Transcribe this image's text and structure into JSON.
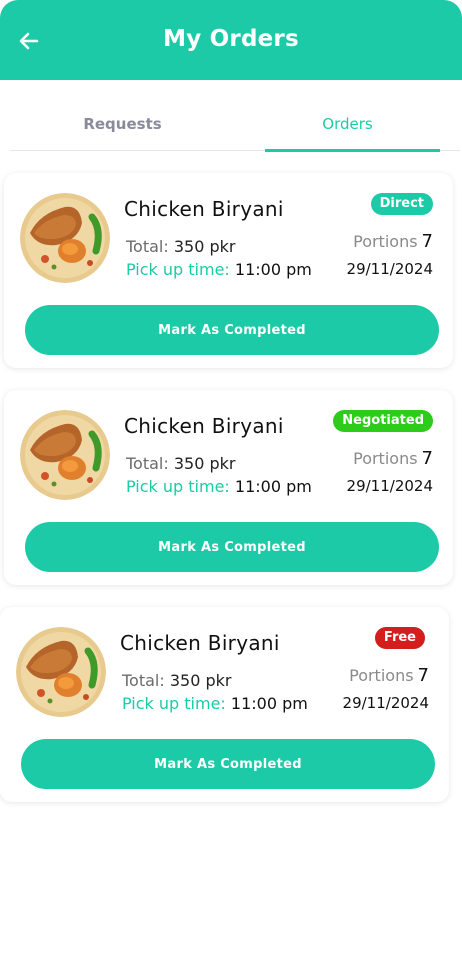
{
  "header": {
    "title": "My Orders",
    "back_icon": "arrow-left-icon",
    "color": "#1dcaa7"
  },
  "tabs": [
    {
      "label": "Requests",
      "active": false
    },
    {
      "label": "Orders",
      "active": true
    }
  ],
  "orders": [
    {
      "name": "Chicken Biryani",
      "badge": "Direct",
      "badge_color": "#1dcaa7",
      "total_label": "Total:",
      "total_value": "350 pkr",
      "pickup_label": "Pick up time:",
      "pickup_value": "11:00 pm",
      "portions_label": "Portions",
      "portions_value": "7",
      "date": "29/11/2024",
      "button_label": "Mark As Completed"
    },
    {
      "name": "Chicken Biryani",
      "badge": "Negotiated",
      "badge_color": "#2ecc1a",
      "total_label": "Total:",
      "total_value": "350 pkr",
      "pickup_label": "Pick up time:",
      "pickup_value": "11:00 pm",
      "portions_label": "Portions",
      "portions_value": "7",
      "date": "29/11/2024",
      "button_label": "Mark As Completed"
    },
    {
      "name": "Chicken Biryani",
      "badge": "Free",
      "badge_color": "#d41e1e",
      "total_label": "Total:",
      "total_value": "350 pkr",
      "pickup_label": "Pick up time:",
      "pickup_value": "11:00 pm",
      "portions_label": "Portions",
      "portions_value": "7",
      "date": "29/11/2024",
      "button_label": "Mark As Completed"
    }
  ]
}
